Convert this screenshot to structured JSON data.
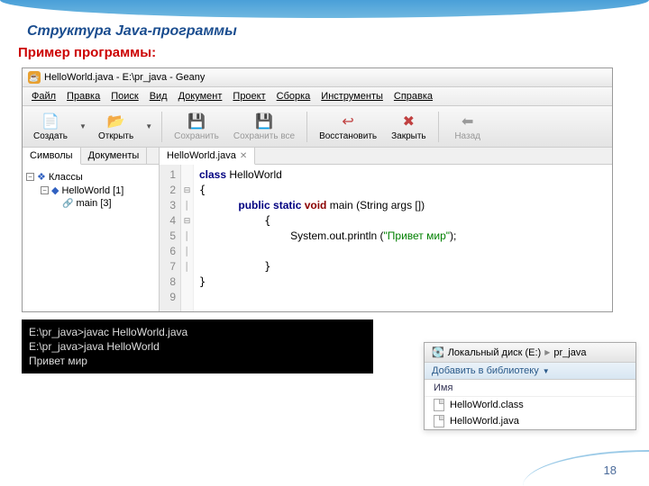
{
  "slide": {
    "title": "Структура Java-программы",
    "subtitle": "Пример программы:",
    "pageNum": "18"
  },
  "ide": {
    "windowTitle": "HelloWorld.java - E:\\pr_java - Geany",
    "menu": [
      "Файл",
      "Правка",
      "Поиск",
      "Вид",
      "Документ",
      "Проект",
      "Сборка",
      "Инструменты",
      "Справка"
    ],
    "toolbar": {
      "create": "Создать",
      "open": "Открыть",
      "save": "Сохранить",
      "saveAll": "Сохранить все",
      "restore": "Восстановить",
      "close": "Закрыть",
      "back": "Назад"
    },
    "sideTabs": {
      "symbols": "Символы",
      "documents": "Документы"
    },
    "tree": {
      "classes": "Классы",
      "helloWorld": "HelloWorld [1]",
      "main": "main [3]"
    },
    "editorTab": "HelloWorld.java",
    "lines": [
      "1",
      "2",
      "3",
      "4",
      "5",
      "6",
      "7",
      "8",
      "9"
    ],
    "code": {
      "classKw": "class",
      "className": " HelloWorld",
      "pubStatic": "public static ",
      "voidKw": "void",
      "mainSig": " main (String args [])",
      "sysOut": "System.out.println (",
      "str": "\"Привет мир\"",
      "endParen": ");"
    }
  },
  "console": {
    "l1": "E:\\pr_java>javac HelloWorld.java",
    "l2": "",
    "l3": "E:\\pr_java>java HelloWorld",
    "l4": "Привет мир"
  },
  "explorer": {
    "bc1": "Локальный диск (E:)",
    "bc2": "pr_java",
    "addLib": "Добавить в библиотеку",
    "colName": "Имя",
    "files": [
      "HelloWorld.class",
      "HelloWorld.java"
    ]
  }
}
